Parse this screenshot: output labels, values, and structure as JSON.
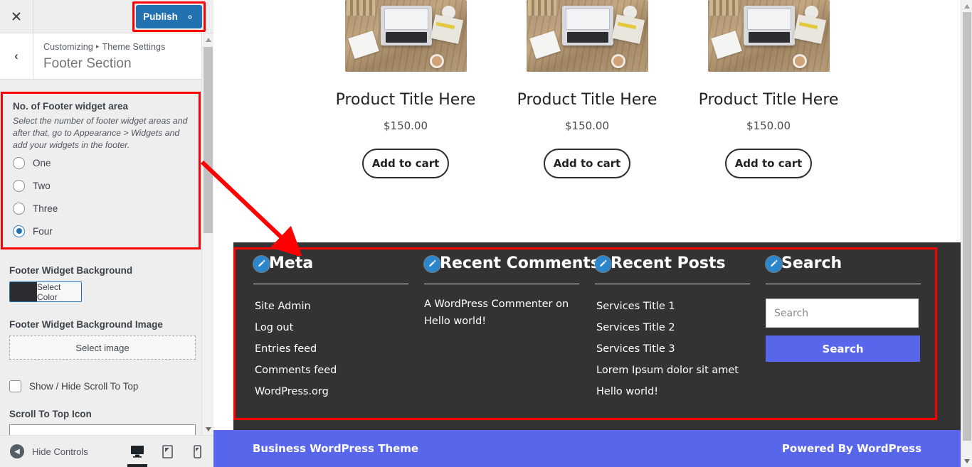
{
  "customizer": {
    "close_label": "×",
    "publish_label": "Publish",
    "gear_icon": "gear-icon",
    "back_label": "‹",
    "breadcrumb_root": "Customizing",
    "breadcrumb_sep": "▸",
    "breadcrumb_parent": "Theme Settings",
    "section_title": "Footer Section",
    "controls": {
      "widget_count": {
        "label": "No. of Footer widget area",
        "description": "Select the number of footer widget areas and after that, go to Appearance > Widgets and add your widgets in the footer.",
        "options": [
          {
            "label": "One",
            "checked": false
          },
          {
            "label": "Two",
            "checked": false
          },
          {
            "label": "Three",
            "checked": false
          },
          {
            "label": "Four",
            "checked": true
          }
        ]
      },
      "widget_background": {
        "label": "Footer Widget Background",
        "button_label": "Select Color",
        "swatch_color": "#2b2d31"
      },
      "widget_background_image": {
        "label": "Footer Widget Background Image",
        "button_label": "Select image"
      },
      "scroll_to_top_toggle": {
        "label": "Show / Hide Scroll To Top",
        "checked": false
      },
      "scroll_to_top_icon": {
        "label": "Scroll To Top Icon",
        "value": ""
      }
    },
    "footer_bar": {
      "hide_controls_label": "Hide Controls",
      "devices": [
        {
          "name": "desktop",
          "active": true
        },
        {
          "name": "tablet",
          "active": false
        },
        {
          "name": "mobile",
          "active": false
        }
      ]
    }
  },
  "preview": {
    "products": [
      {
        "title": "Product Title Here",
        "price": "$150.00",
        "cta": "Add to cart"
      },
      {
        "title": "Product Title Here",
        "price": "$150.00",
        "cta": "Add to cart"
      },
      {
        "title": "Product Title Here",
        "price": "$150.00",
        "cta": "Add to cart"
      }
    ],
    "footer_widgets": [
      {
        "title": "Meta",
        "edit_icon": "pencil-icon",
        "items": [
          "Site Admin",
          "Log out",
          "Entries feed",
          "Comments feed",
          "WordPress.org"
        ]
      },
      {
        "title": "Recent Comments",
        "edit_icon": "pencil-icon",
        "text": "A WordPress Commenter on Hello world!"
      },
      {
        "title": "Recent Posts",
        "edit_icon": "pencil-icon",
        "items": [
          "Services Title 1",
          "Services Title 2",
          "Services Title 3",
          "Lorem Ipsum dolor sit amet",
          "Hello world!"
        ]
      },
      {
        "title": "Search",
        "edit_icon": "pencil-icon",
        "search_placeholder": "Search",
        "search_button": "Search"
      }
    ],
    "bottom_bar": {
      "left": "Business WordPress Theme",
      "right": "Powered By WordPress"
    }
  },
  "colors": {
    "publish_blue": "#2271b1",
    "accent_purple": "#5766ea",
    "footer_dark": "#333333",
    "highlight_red": "#ff0000",
    "edit_icon_blue": "#2b87c9"
  }
}
